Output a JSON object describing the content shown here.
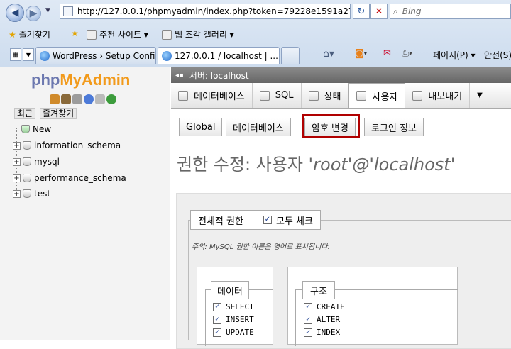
{
  "browser": {
    "address": "http://127.0.0.1/phpmyadmin/index.php?token=79228e1591a27356a",
    "search_placeholder": "Bing",
    "favorites_label": "즐겨찾기",
    "recommended_sites": "추천 사이트 ▾",
    "web_slice_gallery": "웹 조각 갤러리 ▾",
    "tabs": [
      {
        "label": "WordPress › Setup Config..."
      },
      {
        "label": "127.0.0.1 / localhost | ..."
      }
    ],
    "toolbar": {
      "page": "페이지(P) ▾",
      "safety": "안전(S)"
    }
  },
  "sidebar": {
    "logo_php": "php",
    "logo_my": "My",
    "logo_admin": "Admin",
    "tab_recent": "최근",
    "tab_favorites": "즐겨찾기",
    "tree": [
      {
        "label": "New"
      },
      {
        "label": "information_schema"
      },
      {
        "label": "mysql"
      },
      {
        "label": "performance_schema"
      },
      {
        "label": "test"
      }
    ]
  },
  "server_bar": "서버: localhost",
  "top_menu": [
    {
      "label": "데이터베이스"
    },
    {
      "label": "SQL"
    },
    {
      "label": "상태"
    },
    {
      "label": "사용자"
    },
    {
      "label": "내보내기"
    }
  ],
  "sub_tabs": [
    {
      "label": "Global"
    },
    {
      "label": "데이터베이스"
    },
    {
      "label": "암호 변경"
    },
    {
      "label": "로그인 정보"
    }
  ],
  "heading_prefix": "권한 수정: 사용자 ",
  "heading_user": "'root'@'localhost'",
  "global_privileges": {
    "legend": "전체적 권한",
    "check_all": "모두 체크",
    "note": "주의: MySQL 권한 이름은 영어로 표시됩니다.",
    "groups": [
      {
        "title": "데이터",
        "items": [
          "SELECT",
          "INSERT",
          "UPDATE"
        ]
      },
      {
        "title": "구조",
        "items": [
          "CREATE",
          "ALTER",
          "INDEX"
        ]
      }
    ]
  },
  "colors": {
    "highlight_border": "#b00000",
    "logo_blue": "#6c78af",
    "logo_orange": "#f29a1b"
  }
}
